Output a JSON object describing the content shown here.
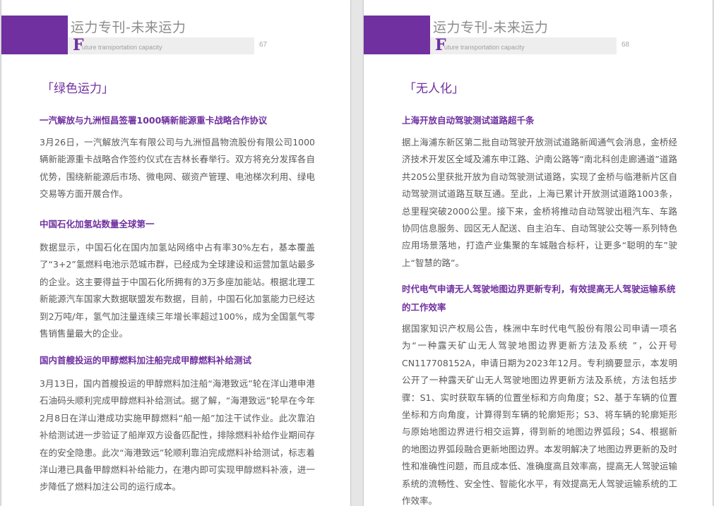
{
  "header": {
    "title": "运力专刊-未来运力",
    "sub_initial": "F",
    "sub_rest": "uture transportation capacity"
  },
  "pages": [
    {
      "number": "67",
      "section": "「绿色运力」",
      "articles": [
        {
          "title": "一汽解放与九洲恒昌签署1000辆新能源重卡战略合作协议",
          "body": "3月26日，一汽解放汽车有限公司与九洲恒昌物流股份有限公司1000辆新能源重卡战略合作签约仪式在吉林长春举行。双方将充分发挥各自优势，围绕新能源后市场、微电网、碳资产管理、电池梯次利用、绿电交易等方面开展合作。"
        },
        {
          "title": "中国石化加氢站数量全球第一",
          "body": "数据显示，中国石化在国内加氢站网络中占有率30%左右，基本覆盖了“3+2”氢燃料电池示范城市群，已经成为全球建设和运营加氢站最多的企业。这主要得益于中国石化所拥有的3万多座加能站。根据北理工新能源汽车国家大数据联盟发布数据，目前，中国石化加氢能力已经达到2万吨/年，氢气加注量连续三年增长率超过100%，成为全国氢气零售销售量最大的企业。"
        },
        {
          "title": "国内首艘投运的甲醇燃料加注船完成甲醇燃料补给测试",
          "body": "3月13日，国内首艘投运的甲醇燃料加注船“海港致远”轮在洋山港申港石油码头顺利完成甲醇燃料补给测试。据了解，“海港致远”轮早在今年2月8日在洋山港成功实施甲醇燃料“船一船”加注干试作业。此次靠泊补给测试进一步验证了船岸双方设备匹配性，排除燃料补给作业期间存在的安全隐患。此次“海港致远”轮顺利靠泊完成燃料补给测试，标志着洋山港已具备甲醇燃料补给能力，在港内即可实现甲醇燃料补液，进一步降低了燃料加注公司的运行成本。"
        }
      ]
    },
    {
      "number": "68",
      "section": "「无人化」",
      "articles": [
        {
          "title": "上海开放自动驾驶测试道路超千条",
          "body": "据上海浦东新区第二批自动驾驶开放测试道路新闻通气会消息，金桥经济技术开发区全域及浦东申江路、沪南公路等“南北科创走廊通道”道路共205公里获批开放为自动驾驶测试道路，实现了金桥与临港新片区自动驾驶测试道路互联互通。至此，上海已累计开放测试道路1003条，总里程突破2000公里。接下来，金桥将推动自动驾驶出租汽车、车路协同信息服务、园区无人配送、自主泊车、自动驾驶公交等一系列特色应用场景落地，打造产业集聚的车城融合标杆，让更多“聪明的车”驶上“智慧的路”。"
        },
        {
          "title": "时代电气申请无人驾驶地图边界更新专利，有效提高无人驾驶运输系统的工作效率",
          "body": "据国家知识产权局公告，株洲中车时代电气股份有限公司申请一项名为“一种露天矿山无人驾驶地图边界更新方法及系统 ”，公开号CN117708152A，申请日期为2023年12月。专利摘要显示，本发明公开了一种露天矿山无人驾驶地图边界更新方法及系统，方法包括步骤：S1、实时获取车辆的位置坐标和方向角度；S2、基于车辆的位置坐标和方向角度，计算得到车辆的轮廓矩形；S3、将车辆的轮廓矩形与原始地图边界进行相交运算，得到新的地图边界弧段；S4、根据新的地图边界弧段融合更新地图边界。本发明解决了地图边界更新的及时性和准确性问题，而且成本低、准确度高且效率高，提高无人驾驶运输系统的流畅性、安全性、智能化水平，有效提高无人驾驶运输系统的工作效率。"
        }
      ]
    }
  ]
}
